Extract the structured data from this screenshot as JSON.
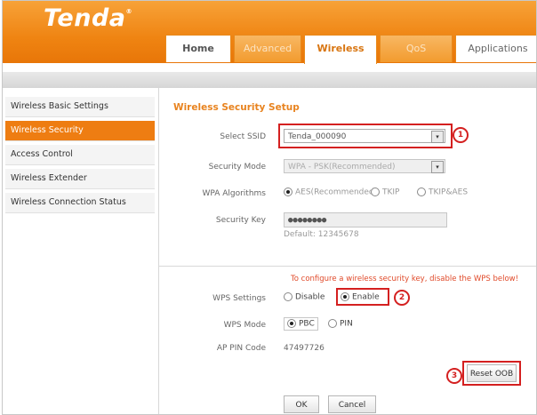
{
  "brand": {
    "logo": "Tenda",
    "logo_mark": "®"
  },
  "tabs": [
    {
      "label": "Home",
      "state": "plain"
    },
    {
      "label": "Advanced",
      "state": "inactive"
    },
    {
      "label": "Wireless",
      "state": "active"
    },
    {
      "label": "QoS",
      "state": "inactive"
    },
    {
      "label": "Applications",
      "state": "inactive"
    }
  ],
  "sidebar": {
    "items": [
      {
        "label": "Wireless Basic Settings",
        "active": false
      },
      {
        "label": "Wireless Security",
        "active": true
      },
      {
        "label": "Access Control",
        "active": false
      },
      {
        "label": "Wireless Extender",
        "active": false
      },
      {
        "label": "Wireless Connection Status",
        "active": false
      }
    ]
  },
  "form": {
    "title": "Wireless Security Setup",
    "ssid": {
      "label": "Select SSID",
      "value": "Tenda_000090"
    },
    "security_mode": {
      "label": "Security Mode",
      "value": "WPA - PSK(Recommended)"
    },
    "wpa_algorithms": {
      "label": "WPA Algorithms",
      "options": [
        "AES(Recommended)",
        "TKIP",
        "TKIP&AES"
      ],
      "selected": "AES(Recommended)"
    },
    "security_key": {
      "label": "Security Key",
      "value": "●●●●●●●●",
      "default_hint": "Default: 12345678"
    },
    "wps_notice": "To configure a wireless security key, disable the WPS below!",
    "wps_settings": {
      "label": "WPS Settings",
      "options": [
        "Disable",
        "Enable"
      ],
      "selected": "Enable"
    },
    "wps_mode": {
      "label": "WPS Mode",
      "options": [
        "PBC",
        "PIN"
      ],
      "selected": "PBC"
    },
    "ap_pin": {
      "label": "AP PIN Code",
      "value": "47497726"
    },
    "reset_button": "Reset OOB",
    "ok_button": "OK",
    "cancel_button": "Cancel"
  },
  "annotations": [
    "1",
    "2",
    "3"
  ],
  "colors": {
    "brand_orange": "#ef8412",
    "highlight_red": "#d42020",
    "title_orange": "#e8831f",
    "notice_red": "#e04a2a"
  }
}
